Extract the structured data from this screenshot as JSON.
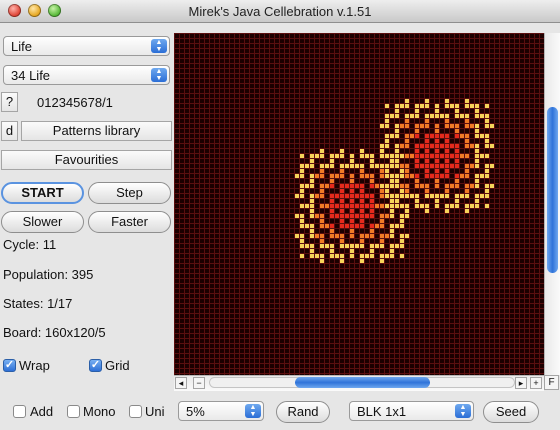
{
  "window": {
    "title": "Mirek's Java Cellebration v.1.51"
  },
  "rules": {
    "family": "Life",
    "rule": "34 Life",
    "help_label": "?",
    "rule_string": "012345678/1",
    "doc_label": "d",
    "patterns_label": "Patterns library",
    "favourites_label": "Favourities"
  },
  "controls": {
    "start_label": "START",
    "step_label": "Step",
    "slower_label": "Slower",
    "faster_label": "Faster"
  },
  "stats": {
    "cycle": "Cycle: 11",
    "population": "Population: 395",
    "states": "States: 1/17",
    "board": "Board: 160x120/5"
  },
  "options": {
    "wrap_label": "Wrap",
    "wrap": true,
    "grid_label": "Grid",
    "grid": true
  },
  "bottom": {
    "add_label": "Add",
    "add": false,
    "mono_label": "Mono",
    "mono": false,
    "uni_label": "Uni",
    "uni": false,
    "density": "5%",
    "rand_label": "Rand",
    "brush": "BLK 1x1",
    "seed_label": "Seed"
  },
  "scroll": {
    "fit_label": "F"
  },
  "colors": {
    "board_bg": "#1c0000",
    "grid": "#5a0f0f",
    "cell_red": "#e52a1c",
    "cell_orange": "#f07a26",
    "cell_yellow": "#f6d45a",
    "accent": "#2f73d9"
  }
}
